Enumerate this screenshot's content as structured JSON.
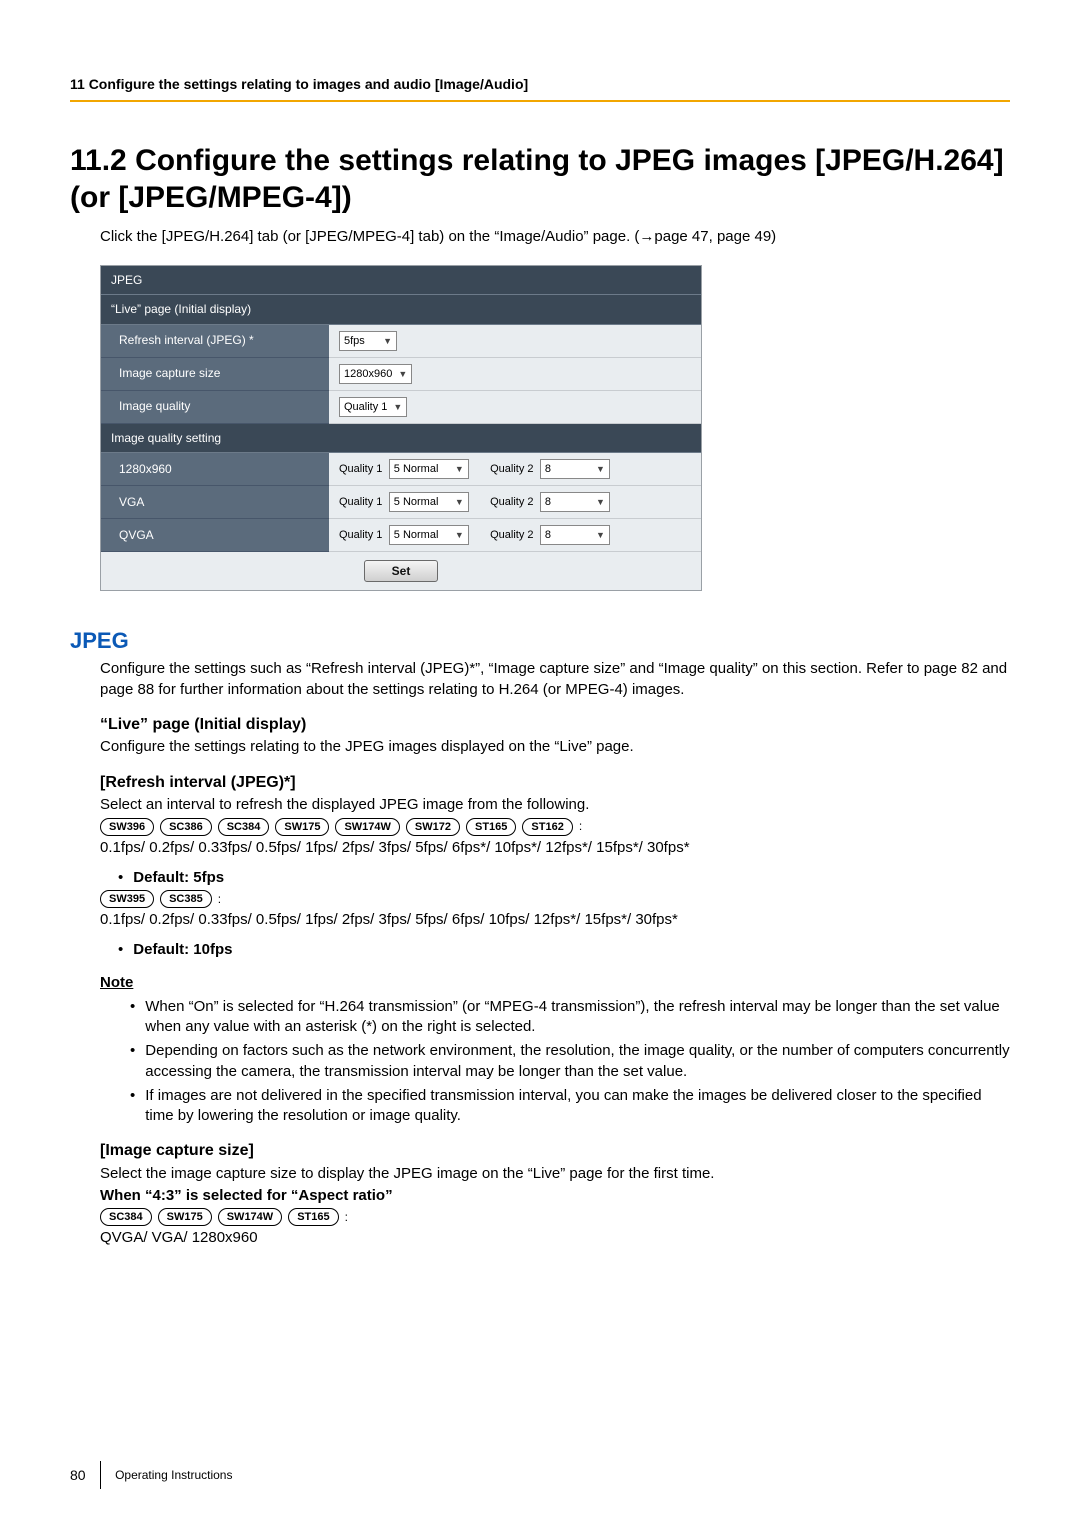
{
  "running_head": "11 Configure the settings relating to images and audio [Image/Audio]",
  "title": "11.2  Configure the settings relating to JPEG images [JPEG/H.264] (or [JPEG/MPEG-4])",
  "intro": "Click the [JPEG/H.264] tab (or [JPEG/MPEG-4] tab) on the “Image/Audio” page. (→page 47, page 49)",
  "panel": {
    "jpeg_header": "JPEG",
    "live_header": "“Live” page (Initial display)",
    "rows": {
      "refresh_label": "Refresh interval (JPEG) *",
      "refresh_value": "5fps",
      "capsize_label": "Image capture size",
      "capsize_value": "1280x960",
      "imgqual_label": "Image quality",
      "imgqual_value": "Quality 1"
    },
    "iq_setting_header": "Image quality setting",
    "iq_rows": [
      {
        "label": "1280x960",
        "q1": "5 Normal",
        "q2": "8"
      },
      {
        "label": "VGA",
        "q1": "5 Normal",
        "q2": "8"
      },
      {
        "label": "QVGA",
        "q1": "5 Normal",
        "q2": "8"
      }
    ],
    "quality1_label": "Quality 1",
    "quality2_label": "Quality 2",
    "set_label": "Set"
  },
  "section_jpeg_title": "JPEG",
  "section_jpeg_para": "Configure the settings such as “Refresh interval (JPEG)*”, “Image capture size” and “Image quality” on this section. Refer to page 82 and page 88 for further information about the settings relating to H.264 (or MPEG-4) images.",
  "live_h": "“Live” page (Initial display)",
  "live_p": "Configure the settings relating to the JPEG images displayed on the “Live” page.",
  "refresh_h": "[Refresh interval (JPEG)*]",
  "refresh_p": "Select an interval to refresh the displayed JPEG image from the following.",
  "model_lines": {
    "line1_tags": [
      "SW396",
      "SC386",
      "SC384",
      "SW175",
      "SW174W",
      "SW172",
      "ST165",
      "ST162"
    ],
    "line1_suffix": ":",
    "line1_values": "0.1fps/ 0.2fps/ 0.33fps/ 0.5fps/ 1fps/ 2fps/ 3fps/ 5fps/ 6fps*/ 10fps*/ 12fps*/ 15fps*/ 30fps*",
    "line1_default": "Default: 5fps",
    "line2_tags": [
      "SW395",
      "SC385"
    ],
    "line2_suffix": ":",
    "line2_values": "0.1fps/ 0.2fps/ 0.33fps/ 0.5fps/ 1fps/ 2fps/ 3fps/ 5fps/ 6fps/ 10fps/ 12fps*/ 15fps*/ 30fps*",
    "line2_default": "Default: 10fps"
  },
  "note_h": "Note",
  "notes": [
    "When “On” is selected for “H.264 transmission” (or “MPEG-4 transmission”), the refresh interval may be longer than the set value when any value with an asterisk (*) on the right is selected.",
    "Depending on factors such as the network environment, the resolution, the image quality, or the number of computers concurrently accessing the camera, the transmission interval may be longer than the set value.",
    "If images are not delivered in the specified transmission interval, you can make the images be delivered closer to the specified time by lowering the resolution or image quality."
  ],
  "capsize_h": "[Image capture size]",
  "capsize_p": "Select the image capture size to display the JPEG image on the “Live” page for the first time.",
  "aspect_h": "When “4:3” is selected for “Aspect ratio”",
  "aspect_tags": [
    "SC384",
    "SW175",
    "SW174W",
    "ST165"
  ],
  "aspect_suffix": ":",
  "aspect_values": "QVGA/ VGA/ 1280x960",
  "footer": {
    "page": "80",
    "label": "Operating Instructions"
  }
}
